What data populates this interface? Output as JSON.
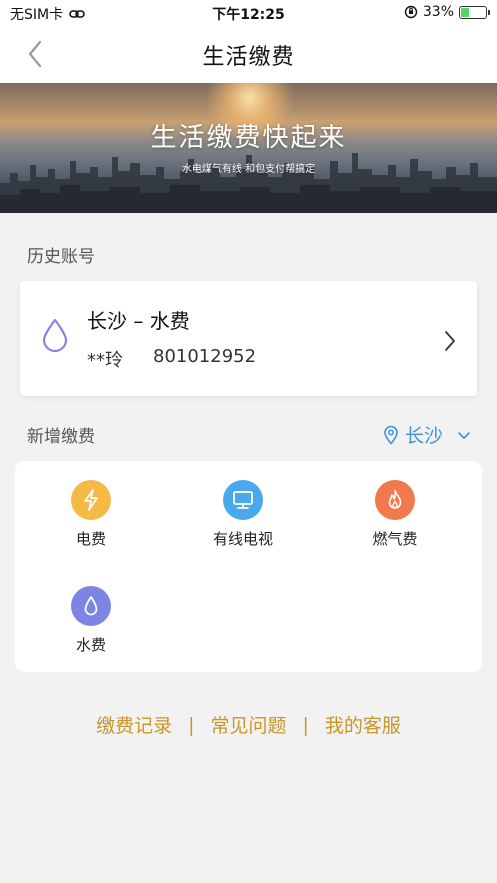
{
  "status_bar": {
    "carrier": "无SIM卡",
    "time": "下午12:25",
    "battery_percent": "33%",
    "battery_level": 0.33
  },
  "nav": {
    "title": "生活缴费",
    "back_icon": "chevron-left-icon"
  },
  "banner": {
    "title": "生活缴费快起来",
    "subtitle": "水电煤气有线  和包支付帮搞定"
  },
  "history": {
    "label": "历史账号",
    "account": {
      "title": "长沙 – 水费",
      "name": "**玲",
      "number": "801012952",
      "icon": "water-drop-icon"
    }
  },
  "new_payment": {
    "label": "新增缴费",
    "city": "长沙",
    "items": [
      {
        "label": "电费",
        "icon": "lightning-icon",
        "color": "#f5b945"
      },
      {
        "label": "有线电视",
        "icon": "monitor-icon",
        "color": "#4aa9ec"
      },
      {
        "label": "燃气费",
        "icon": "flame-icon",
        "color": "#f0794d"
      },
      {
        "label": "水费",
        "icon": "water-drop-icon",
        "color": "#7c85e3"
      }
    ]
  },
  "footer": {
    "records": "缴费记录",
    "faq": "常见问题",
    "service": "我的客服"
  },
  "colors": {
    "accent_gold": "#c9962a",
    "location_blue": "#3d95d6",
    "drop_outline": "#8a84e6"
  }
}
